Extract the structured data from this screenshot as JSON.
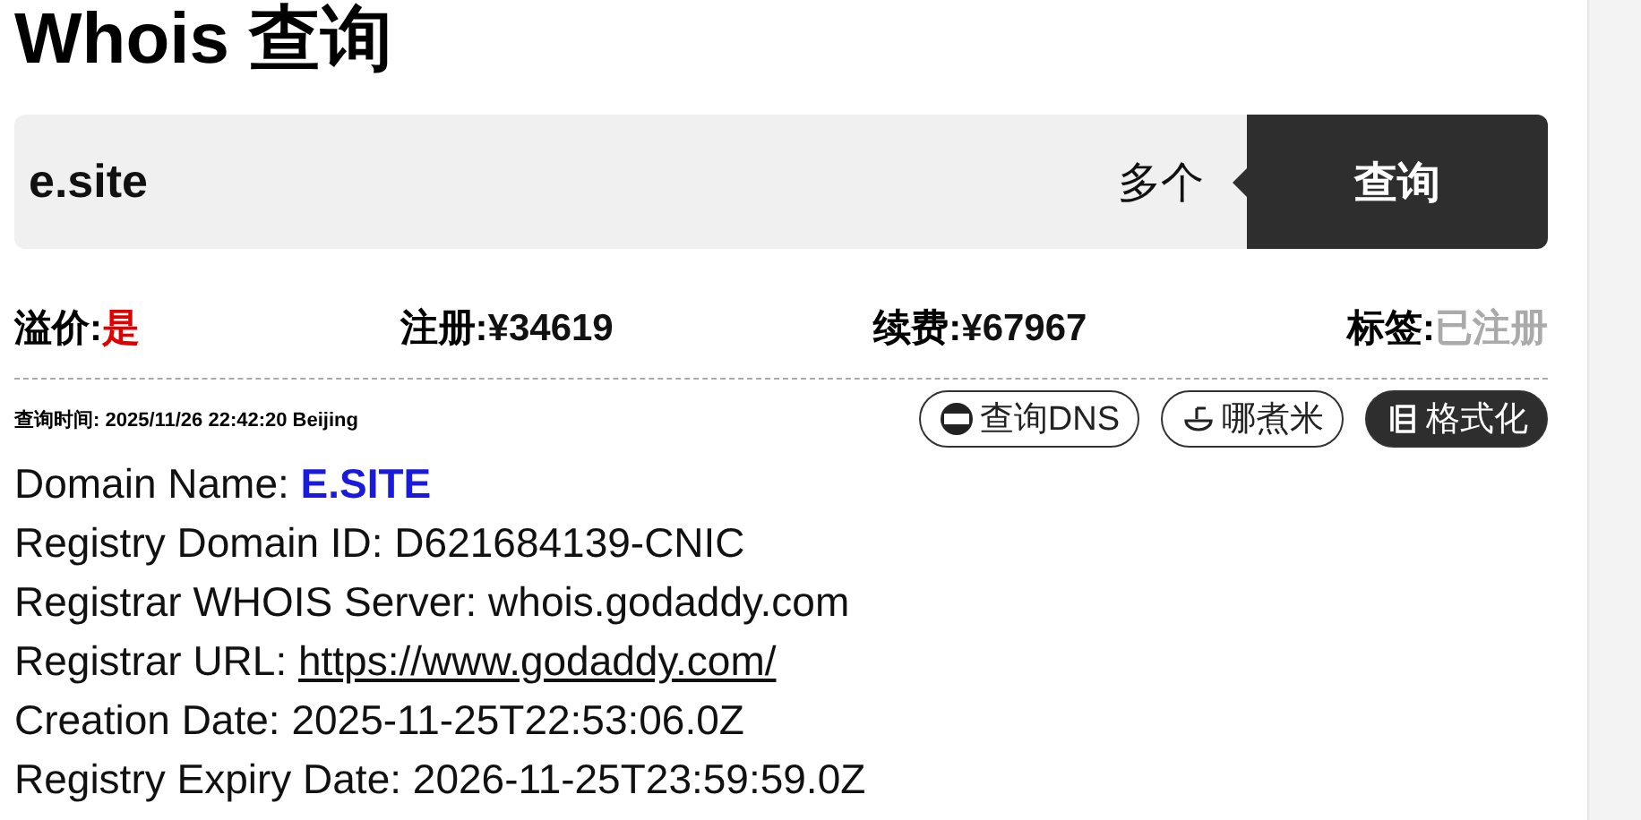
{
  "title": "Whois 查询",
  "search": {
    "value": "e.site",
    "multi_label": "多个",
    "button": "查询"
  },
  "stats": [
    {
      "label": "溢价:",
      "value": "是",
      "color": "#e00000"
    },
    {
      "label": "注册:",
      "value": "¥34619",
      "color": "#111111"
    },
    {
      "label": "续费:",
      "value": "¥67967",
      "color": "#111111"
    },
    {
      "label": "标签:",
      "value": "已注册",
      "color": "#aaaaaa"
    }
  ],
  "query_time": "查询时间: 2025/11/26 22:42:20 Beijing",
  "actions": [
    {
      "label": "查询DNS",
      "selected": false
    },
    {
      "label": "哪煮米",
      "selected": false
    },
    {
      "label": "格式化",
      "selected": true
    }
  ],
  "whois": [
    {
      "label": "Domain Name: ",
      "value": "E.SITE",
      "kind": "highlight"
    },
    {
      "label": "Registry Domain ID: ",
      "value": "D621684139-CNIC",
      "kind": "text"
    },
    {
      "label": "Registrar WHOIS Server: ",
      "value": "whois.godaddy.com",
      "kind": "text"
    },
    {
      "label": "Registrar URL: ",
      "value": "https://www.godaddy.com/",
      "kind": "link"
    },
    {
      "label": "Creation Date: ",
      "value": "2025-11-25T22:53:06.0Z",
      "kind": "text"
    },
    {
      "label": "Registry Expiry Date: ",
      "value": "2026-11-25T23:59:59.0Z",
      "kind": "text"
    }
  ]
}
